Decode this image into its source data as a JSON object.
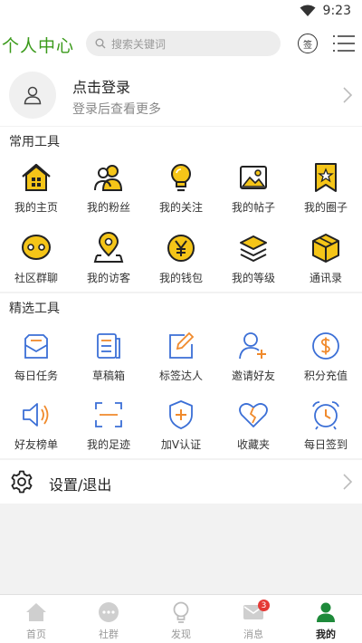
{
  "status": {
    "time": "9:23"
  },
  "header": {
    "title": "个人中心",
    "search_placeholder": "搜索关键词",
    "signin_glyph": "签"
  },
  "profile": {
    "login_title": "点击登录",
    "login_subtitle": "登录后查看更多"
  },
  "common_tools": {
    "title": "常用工具",
    "items": [
      {
        "label": "我的主页",
        "icon": "home-icon"
      },
      {
        "label": "我的粉丝",
        "icon": "fans-icon"
      },
      {
        "label": "我的关注",
        "icon": "bulb-icon"
      },
      {
        "label": "我的帖子",
        "icon": "image-icon"
      },
      {
        "label": "我的圈子",
        "icon": "star-bookmark-icon"
      },
      {
        "label": "社区群聊",
        "icon": "chat-icon"
      },
      {
        "label": "我的访客",
        "icon": "location-icon"
      },
      {
        "label": "我的钱包",
        "icon": "yen-coin-icon"
      },
      {
        "label": "我的等级",
        "icon": "layers-icon"
      },
      {
        "label": "通讯录",
        "icon": "cube-icon"
      }
    ]
  },
  "featured_tools": {
    "title": "精选工具",
    "items": [
      {
        "label": "每日任务",
        "icon": "task-icon"
      },
      {
        "label": "草稿箱",
        "icon": "draft-icon"
      },
      {
        "label": "标签达人",
        "icon": "edit-icon"
      },
      {
        "label": "邀请好友",
        "icon": "add-user-icon"
      },
      {
        "label": "积分充值",
        "icon": "dollar-icon"
      },
      {
        "label": "好友榜单",
        "icon": "speaker-icon"
      },
      {
        "label": "我的足迹",
        "icon": "scan-icon"
      },
      {
        "label": "加V认证",
        "icon": "shield-plus-icon"
      },
      {
        "label": "收藏夹",
        "icon": "heart-icon"
      },
      {
        "label": "每日签到",
        "icon": "alarm-icon"
      }
    ]
  },
  "settings": {
    "label": "设置/退出"
  },
  "bottom_nav": {
    "items": [
      {
        "label": "首页",
        "icon": "home-icon"
      },
      {
        "label": "社群",
        "icon": "chat-bubble-icon"
      },
      {
        "label": "发现",
        "icon": "bulb-icon"
      },
      {
        "label": "消息",
        "icon": "mail-icon",
        "badge": "3"
      },
      {
        "label": "我的",
        "icon": "person-icon",
        "active": true
      }
    ]
  },
  "colors": {
    "accent_green": "#3a9a1a",
    "tool_yellow": "#f5c518",
    "tool_blue": "#3b6fd6",
    "tool_orange": "#f08a2c",
    "badge_red": "#e53935"
  }
}
